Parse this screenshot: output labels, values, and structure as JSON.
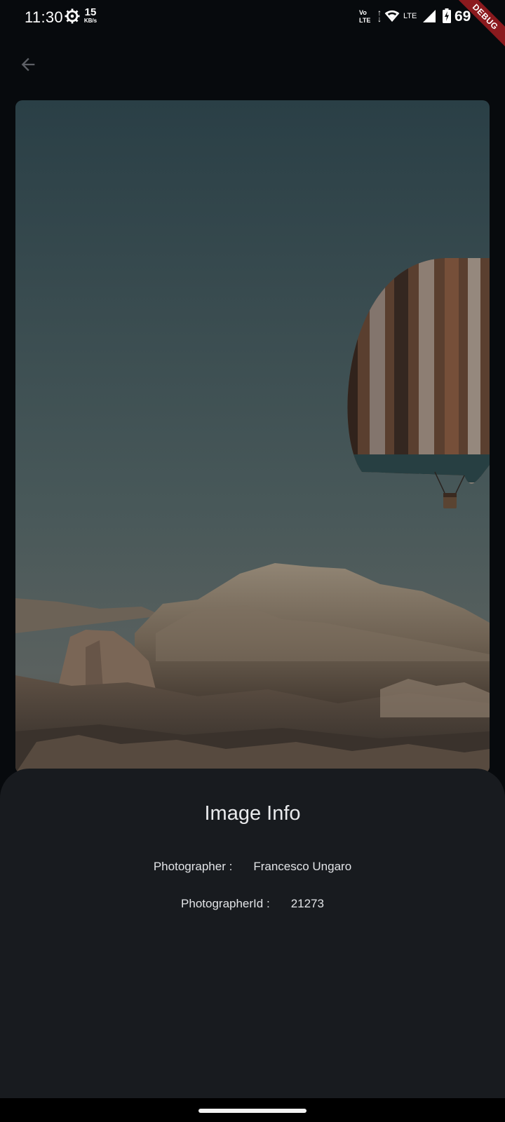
{
  "status_bar": {
    "time": "11:30",
    "net_speed_value": "15",
    "net_speed_unit": "KB/s",
    "volte_line1": "Vo",
    "volte_line2": "LTE",
    "lte_label": "LTE",
    "battery_text": "69",
    "icons": [
      "gear-icon",
      "wifi-icon",
      "signal-icon",
      "battery-charging-icon"
    ]
  },
  "debug_banner": "DEBUG",
  "app_bar": {
    "back_icon": "arrow-left-icon"
  },
  "photo": {
    "subject": "hot-air-balloon-over-mountain",
    "colors": {
      "sky_top": "#2c4148",
      "sky_bottom": "#54605f",
      "mountain": "#8a7a68"
    }
  },
  "sheet": {
    "title": "Image Info",
    "rows": [
      {
        "label": "Photographer :",
        "value": "Francesco Ungaro"
      },
      {
        "label": "PhotographerId :",
        "value": "21273"
      }
    ]
  },
  "colors": {
    "background": "#070a0d",
    "sheet_background": "#181b1f",
    "debug_ribbon": "#8b1a1e"
  }
}
